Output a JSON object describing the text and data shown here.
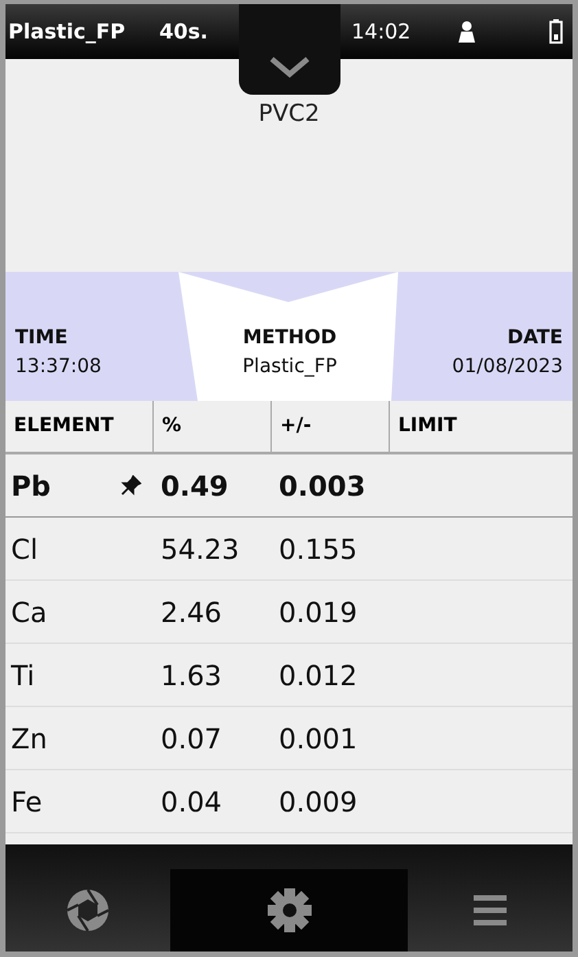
{
  "status_bar": {
    "method": "Plastic_FP",
    "duration": "40s.",
    "clock": "14:02"
  },
  "sample": {
    "name": "PVC2"
  },
  "info": {
    "time_label": "TIME",
    "time": "13:37:08",
    "method_label": "METHOD",
    "method": "Plastic_FP",
    "date_label": "DATE",
    "date": "01/08/2023"
  },
  "table": {
    "columns": [
      "ELEMENT",
      "%",
      "+/-",
      "LIMIT"
    ],
    "rows": [
      {
        "element": "Pb",
        "percent": "0.49",
        "error": "0.003",
        "pinned": true
      },
      {
        "element": "Cl",
        "percent": "54.23",
        "error": "0.155",
        "pinned": false
      },
      {
        "element": "Ca",
        "percent": "2.46",
        "error": "0.019",
        "pinned": false
      },
      {
        "element": "Ti",
        "percent": "1.63",
        "error": "0.012",
        "pinned": false
      },
      {
        "element": "Zn",
        "percent": "0.07",
        "error": "0.001",
        "pinned": false
      },
      {
        "element": "Fe",
        "percent": "0.04",
        "error": "0.009",
        "pinned": false
      }
    ]
  }
}
